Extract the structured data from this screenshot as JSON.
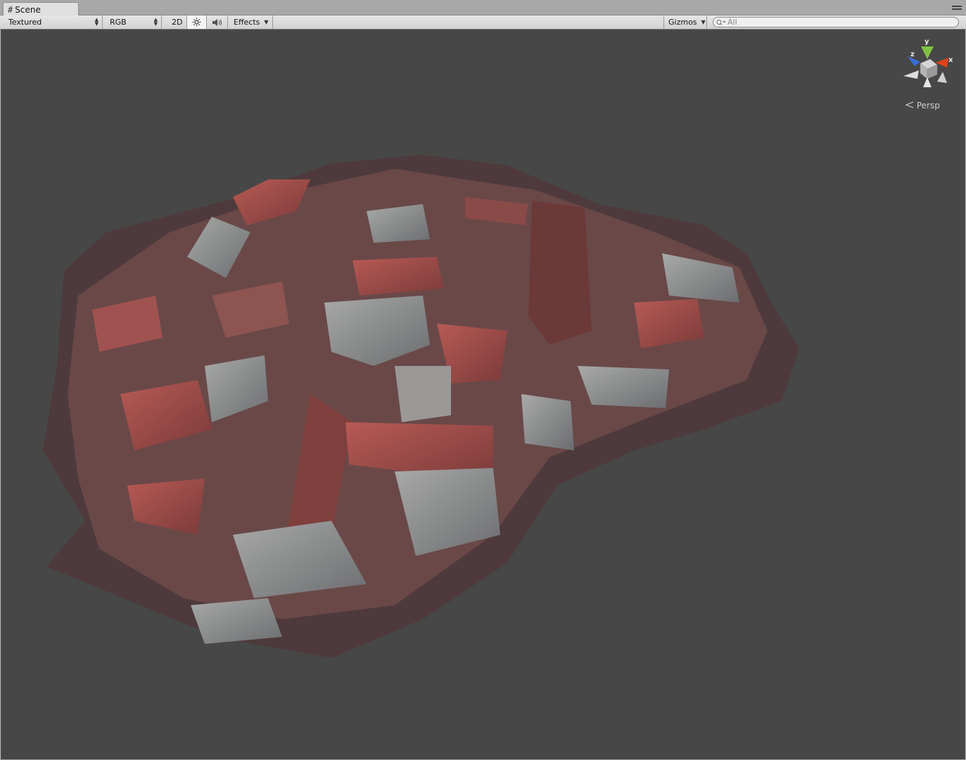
{
  "tab": {
    "title": "Scene"
  },
  "toolbar": {
    "draw_mode": "Textured",
    "render_mode": "RGB",
    "mode_2d": "2D",
    "effects": "Effects",
    "gizmos": "Gizmos",
    "search_placeholder": "All"
  },
  "scene": {
    "view_label": "Persp",
    "axes": {
      "x": "x",
      "y": "y",
      "z": "z"
    },
    "colors": {
      "background": "#474747",
      "x_axis": "#e0411a",
      "y_axis": "#7fc241",
      "z_axis": "#3a6fd8"
    }
  }
}
